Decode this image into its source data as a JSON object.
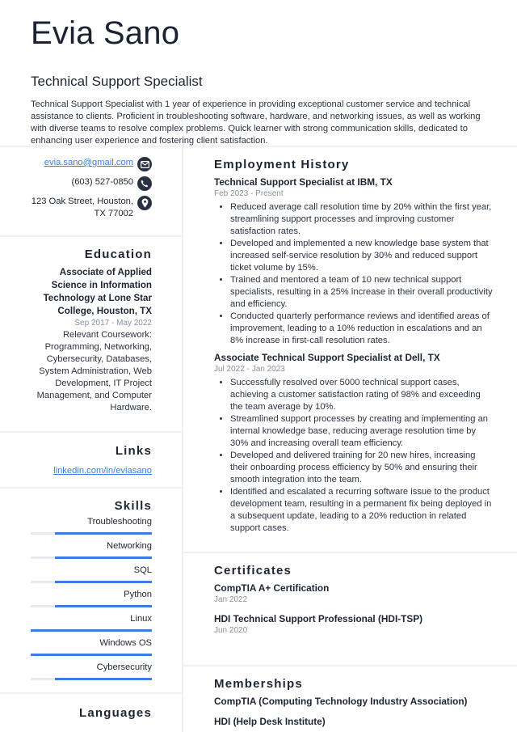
{
  "header": {
    "name": "Evia Sano",
    "title": "Technical Support Specialist",
    "summary": "Technical Support Specialist with 1 year of experience in providing exceptional customer service and technical assistance to clients. Proficient in troubleshooting software, hardware, and networking issues, as well as working with diverse teams to resolve complex problems. Quick learner with strong communication skills, dedicated to enhancing user experience and fostering client satisfaction."
  },
  "contact": {
    "email": "evia.sano@gmail.com",
    "email_icon": "envelope-icon",
    "phone": "(603) 527-0850",
    "phone_icon": "phone-icon",
    "address": "123 Oak Street, Houston, TX 77002",
    "address_icon": "map-pin-icon"
  },
  "education": {
    "heading": "Education",
    "degree": "Associate of Applied Science in Information Technology at Lone Star College, Houston, TX",
    "dates": "Sep 2017 - May 2022",
    "description": "Relevant Coursework: Programming, Networking, Cybersecurity, Databases, System Administration, Web Development, IT Project Management, and Computer Hardware."
  },
  "links": {
    "heading": "Links",
    "items": [
      "linkedin.com/in/eviasano"
    ]
  },
  "skills": {
    "heading": "Skills",
    "items": [
      {
        "name": "Troubleshooting",
        "level": 0.8
      },
      {
        "name": "Networking",
        "level": 0.8
      },
      {
        "name": "SQL",
        "level": 0.8
      },
      {
        "name": "Python",
        "level": 0.8
      },
      {
        "name": "Linux",
        "level": 1.0
      },
      {
        "name": "Windows OS",
        "level": 1.0
      },
      {
        "name": "Cybersecurity",
        "level": 0.8
      }
    ]
  },
  "languages": {
    "heading": "Languages"
  },
  "employment": {
    "heading": "Employment History",
    "jobs": [
      {
        "title": "Technical Support Specialist at IBM, TX",
        "dates": "Feb 2023 - Present",
        "bullets": [
          "Reduced average call resolution time by 20% within the first year, streamlining support processes and improving customer satisfaction rates.",
          "Developed and implemented a new knowledge base system that increased self-service resolution by 30% and reduced support ticket volume by 15%.",
          "Trained and mentored a team of 10 new technical support specialists, resulting in a 25% increase in their overall productivity and efficiency.",
          "Conducted quarterly performance reviews and identified areas of improvement, leading to a 10% reduction in escalations and an 8% increase in first-call resolution rates."
        ]
      },
      {
        "title": "Associate Technical Support Specialist at Dell, TX",
        "dates": "Jul 2022 - Jan 2023",
        "bullets": [
          "Successfully resolved over 5000 technical support cases, achieving a customer satisfaction rating of 98% and exceeding the team average by 10%.",
          "Streamlined support processes by creating and implementing an internal knowledge base, reducing average resolution time by 30% and increasing overall team efficiency.",
          "Developed and delivered training for 20 new hires, increasing their onboarding process efficiency by 50% and ensuring their smooth integration into the team.",
          "Identified and escalated a recurring software issue to the product development team, resulting in a permanent fix being deployed in a subsequent update, leading to a 20% reduction in related support cases."
        ]
      }
    ]
  },
  "certificates": {
    "heading": "Certificates",
    "items": [
      {
        "name": "CompTIA A+ Certification",
        "date": "Jan 2022"
      },
      {
        "name": "HDI Technical Support Professional (HDI-TSP)",
        "date": "Jun 2020"
      }
    ]
  },
  "memberships": {
    "heading": "Memberships",
    "items": [
      "CompTIA (Computing Technology Industry Association)",
      "HDI (Help Desk Institute)"
    ]
  },
  "colors": {
    "accent": "#3b7de0",
    "text": "#1e2532",
    "muted": "#8a909a",
    "divider": "#eef0f3"
  }
}
